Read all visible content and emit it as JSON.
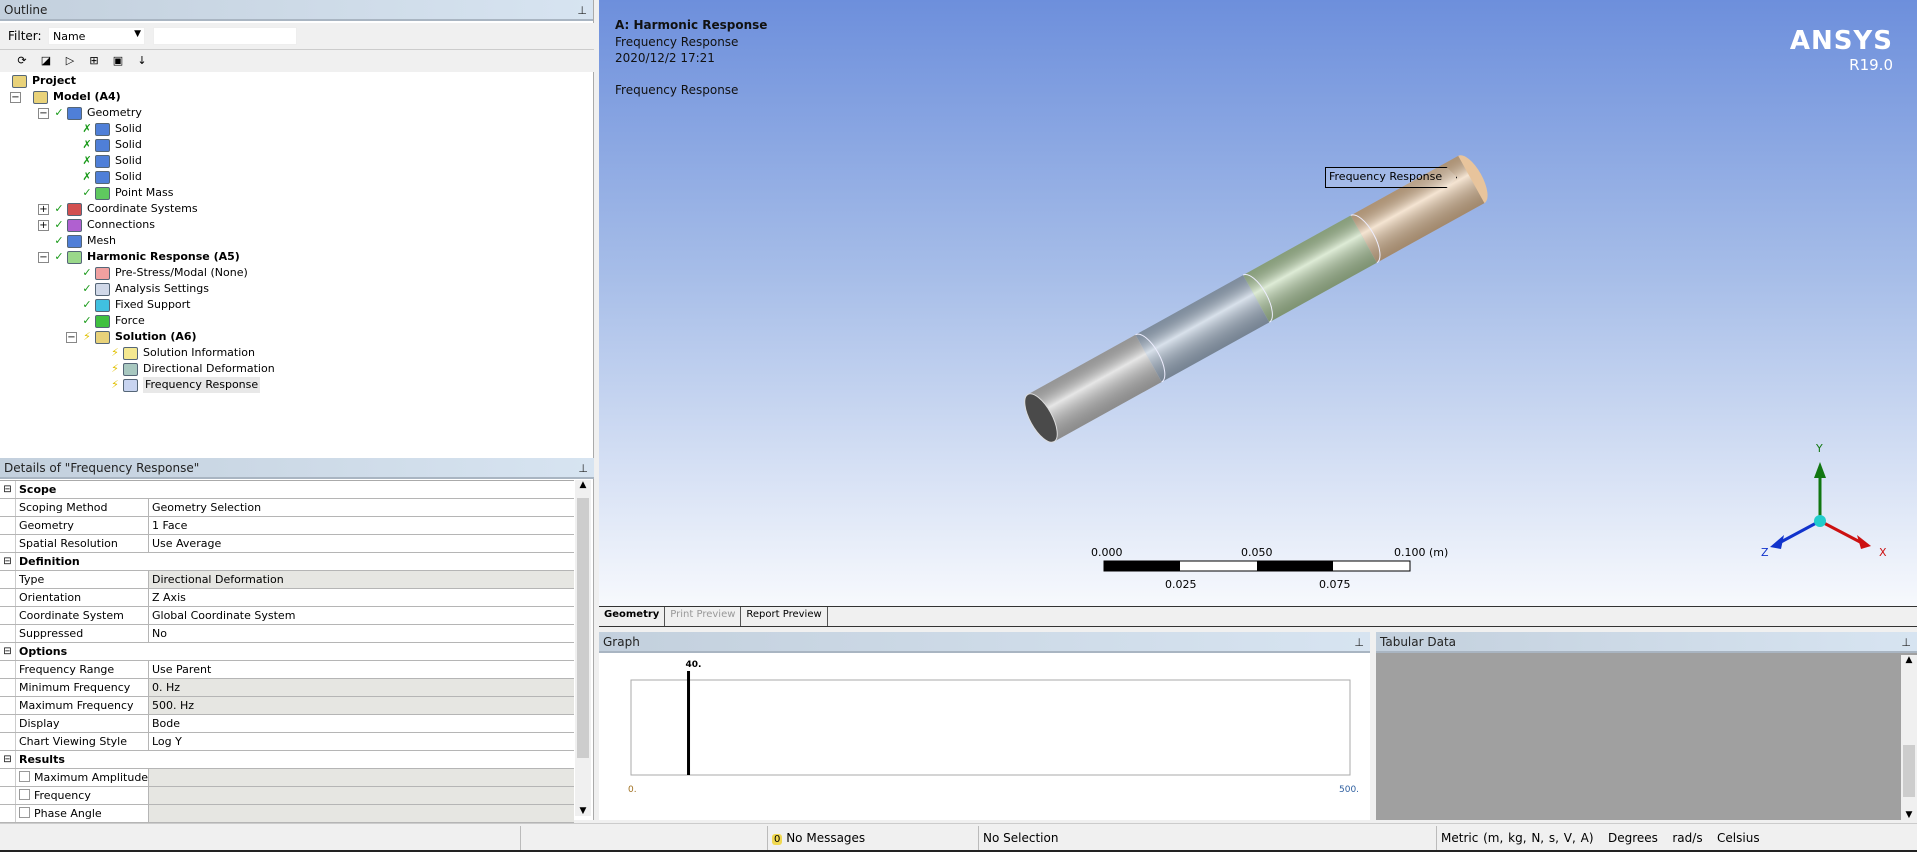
{
  "outline": {
    "title": "Outline",
    "filter_label": "Filter:",
    "filter_value": "Name",
    "filter_text": "",
    "toolbar_icons": [
      "refresh-icon",
      "eraser-icon",
      "tree-expand-icon",
      "expand-all-icon",
      "folder-icon",
      "sort-az-icon"
    ],
    "tree": [
      {
        "label": "Project",
        "level": 0,
        "bold": true,
        "exp": "none",
        "status": "",
        "icon": "project-icon",
        "color": "#e8d27a"
      },
      {
        "label": "Model (A4)",
        "level": 0,
        "bold": true,
        "exp": "minus",
        "status": "",
        "icon": "model-icon",
        "color": "#e8d27a",
        "indent": 1
      },
      {
        "label": "Geometry",
        "level": 1,
        "exp": "minus",
        "status": "check",
        "icon": "geometry-icon",
        "color": "#4f7fd8"
      },
      {
        "label": "Solid",
        "level": 2,
        "exp": "none",
        "status": "x-check",
        "icon": "solid-icon",
        "color": "#4f7fd8"
      },
      {
        "label": "Solid",
        "level": 2,
        "exp": "none",
        "status": "x-check",
        "icon": "solid-icon",
        "color": "#4f7fd8"
      },
      {
        "label": "Solid",
        "level": 2,
        "exp": "none",
        "status": "x-check",
        "icon": "solid-icon",
        "color": "#4f7fd8"
      },
      {
        "label": "Solid",
        "level": 2,
        "exp": "none",
        "status": "x-check",
        "icon": "solid-icon",
        "color": "#4f7fd8"
      },
      {
        "label": "Point Mass",
        "level": 2,
        "exp": "none",
        "status": "check",
        "icon": "point-mass-icon",
        "color": "#5fc85f"
      },
      {
        "label": "Coordinate Systems",
        "level": 1,
        "exp": "plus",
        "status": "check",
        "icon": "coordinate-systems-icon",
        "color": "#d25050"
      },
      {
        "label": "Connections",
        "level": 1,
        "exp": "plus",
        "status": "check",
        "icon": "connections-icon",
        "color": "#b060d0"
      },
      {
        "label": "Mesh",
        "level": 1,
        "exp": "none",
        "status": "check",
        "icon": "mesh-icon",
        "color": "#4f7fd8"
      },
      {
        "label": "Harmonic Response (A5)",
        "level": 1,
        "bold": true,
        "exp": "minus",
        "status": "check",
        "icon": "harmonic-response-icon",
        "color": "#9ad88a"
      },
      {
        "label": "Pre-Stress/Modal (None)",
        "level": 2,
        "exp": "none",
        "status": "check",
        "icon": "pre-stress-icon",
        "color": "#f0a0a0"
      },
      {
        "label": "Analysis Settings",
        "level": 2,
        "exp": "none",
        "status": "check",
        "icon": "analysis-settings-icon",
        "color": "#d0d8e8"
      },
      {
        "label": "Fixed Support",
        "level": 2,
        "exp": "none",
        "status": "check",
        "icon": "fixed-support-icon",
        "color": "#40c0e0"
      },
      {
        "label": "Force",
        "level": 2,
        "exp": "none",
        "status": "check",
        "icon": "force-icon",
        "color": "#40c040"
      },
      {
        "label": "Solution (A6)",
        "level": 2,
        "bold": true,
        "exp": "minus",
        "status": "lightning",
        "icon": "solution-icon",
        "color": "#e8d27a"
      },
      {
        "label": "Solution Information",
        "level": 3,
        "exp": "none",
        "status": "lightning",
        "icon": "solution-information-icon",
        "color": "#f4e890"
      },
      {
        "label": "Directional Deformation",
        "level": 3,
        "exp": "none",
        "status": "lightning",
        "icon": "directional-deformation-icon",
        "color": "#a8c8c0"
      },
      {
        "label": "Frequency Response",
        "level": 3,
        "exp": "none",
        "status": "lightning",
        "icon": "frequency-response-icon",
        "color": "#c8d4f0",
        "selected": true
      }
    ]
  },
  "details": {
    "title": "Details of \"Frequency Response\"",
    "rows": [
      {
        "section": "Scope"
      },
      {
        "name": "Scoping Method",
        "value": "Geometry Selection"
      },
      {
        "name": "Geometry",
        "value": "1 Face"
      },
      {
        "name": "Spatial Resolution",
        "value": "Use Average"
      },
      {
        "section": "Definition"
      },
      {
        "name": "Type",
        "value": "Directional Deformation",
        "readonly": true
      },
      {
        "name": "Orientation",
        "value": "Z Axis"
      },
      {
        "name": "Coordinate System",
        "value": "Global Coordinate System"
      },
      {
        "name": "Suppressed",
        "value": "No"
      },
      {
        "section": "Options"
      },
      {
        "name": "Frequency Range",
        "value": "Use Parent"
      },
      {
        "name": "Minimum Frequency",
        "value": "0. Hz",
        "readonly": true
      },
      {
        "name": "Maximum Frequency",
        "value": "500. Hz",
        "readonly": true
      },
      {
        "name": "Display",
        "value": "Bode"
      },
      {
        "name": "Chart Viewing Style",
        "value": "Log Y"
      },
      {
        "section": "Results"
      },
      {
        "name": "Maximum Amplitude",
        "value": "",
        "readonly": true,
        "checkbox": true
      },
      {
        "name": "Frequency",
        "value": "",
        "readonly": true,
        "checkbox": true
      },
      {
        "name": "Phase Angle",
        "value": "",
        "readonly": true,
        "checkbox": true
      }
    ]
  },
  "viewport": {
    "title": "A: Harmonic Response",
    "subtitle": "Frequency Response",
    "date": "2020/12/2 17:21",
    "result_label": "Frequency Response",
    "brand": "ANSYS",
    "version": "R19.0",
    "annotation": "Frequency Response",
    "body_colors": [
      "#c8c8c8",
      "#a9bcd2",
      "#b5d3a4",
      "#e8c49c"
    ],
    "scale_top": [
      "0.000",
      "0.050",
      "0.100 (m)"
    ],
    "scale_bottom": [
      "0.025",
      "0.075"
    ],
    "axes": {
      "x": "X",
      "y": "Y",
      "z": "Z",
      "x_color": "#cc1111",
      "y_color": "#117711",
      "z_color": "#1133cc"
    }
  },
  "tabs": [
    {
      "label": "Geometry",
      "active": true
    },
    {
      "label": "Print Preview",
      "disabled": true
    },
    {
      "label": "Report Preview"
    }
  ],
  "graph": {
    "title": "Graph",
    "chart_data": {
      "type": "line",
      "xlim": [
        0,
        500
      ],
      "x_tick_labels": [
        "0.",
        "500."
      ],
      "marker_value": 40,
      "marker_label": "40."
    }
  },
  "tabular": {
    "title": "Tabular Data"
  },
  "status": {
    "messages": "No Messages",
    "message_count": "0",
    "selection": "No Selection",
    "units": "Metric (m, kg, N, s, V, A)",
    "angle": "Degrees",
    "rot_vel": "rad/s",
    "temperature": "Celsius"
  }
}
